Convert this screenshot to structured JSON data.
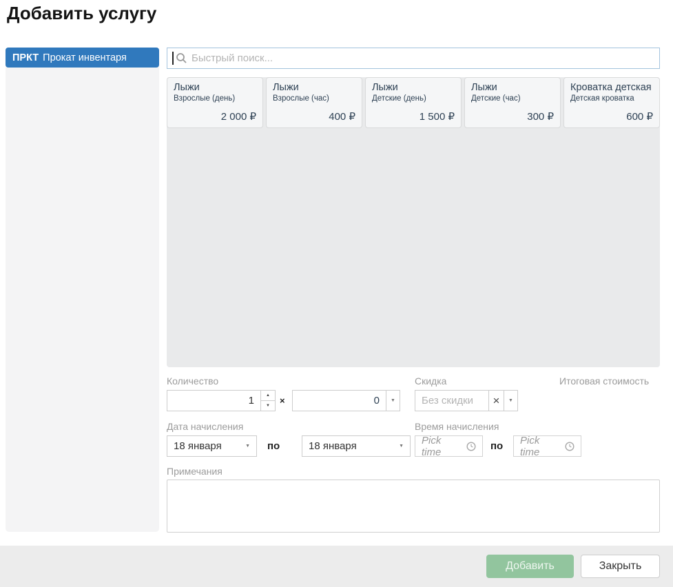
{
  "page_title": "Добавить услугу",
  "colors": {
    "accent_blue": "#3079bd",
    "panel_gray": "#e9eaeb",
    "card_bg": "#f5f6f7",
    "add_button_green": "#92c59e",
    "footer_bg": "#ececec",
    "search_border": "#a3c3dd"
  },
  "sidebar": {
    "group_code": "ПРКТ",
    "group_label": "Прокат инвентаря"
  },
  "search": {
    "placeholder": "Быстрый поиск..."
  },
  "services": {
    "items": [
      {
        "title": "Лыжи",
        "subtitle": "Взрослые (день)",
        "price": "2 000 ₽"
      },
      {
        "title": "Лыжи",
        "subtitle": "Взрослые (час)",
        "price": "400 ₽"
      },
      {
        "title": "Лыжи",
        "subtitle": "Детские (день)",
        "price": "1 500 ₽"
      },
      {
        "title": "Лыжи",
        "subtitle": "Детские (час)",
        "price": "300 ₽"
      },
      {
        "title": "Кроватка детская",
        "subtitle": "Детская кроватка",
        "price": "600 ₽"
      }
    ]
  },
  "form": {
    "quantity_label": "Количество",
    "quantity_value": "1",
    "multiply_sign": "×",
    "multiplier_value": "0",
    "discount_label": "Скидка",
    "discount_placeholder": "Без скидки",
    "clear_sign": "×",
    "total_label": "Итоговая стоимость",
    "date_label": "Дата начисления",
    "date_from": "18 января",
    "date_to": "18 января",
    "range_separator": "по",
    "time_label": "Время начисления",
    "time_placeholder": "Pick time",
    "notes_label": "Примечания",
    "notes_value": "",
    "spinner_up": "▲",
    "spinner_down": "▼",
    "caret_down": "▼"
  },
  "footer": {
    "add_label": "Добавить",
    "close_label": "Закрыть"
  }
}
